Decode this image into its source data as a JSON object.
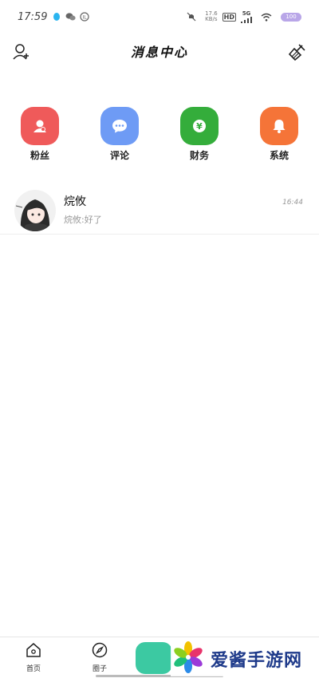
{
  "status_bar": {
    "time": "17:59",
    "net_speed_value": "17.6",
    "net_speed_unit": "KB/s",
    "hd": "HD",
    "signal": "5G",
    "battery": "100"
  },
  "header": {
    "title": "消息中心",
    "left_icon": "add-user-icon",
    "right_icon": "clear-broom-icon"
  },
  "categories": [
    {
      "label": "粉丝",
      "icon": "fans-icon",
      "color": "#ef5a5a"
    },
    {
      "label": "评论",
      "icon": "comment-icon",
      "color": "#6e9bf5"
    },
    {
      "label": "财务",
      "icon": "yuan-icon",
      "color": "#34ad3b"
    },
    {
      "label": "系统",
      "icon": "bell-icon",
      "color": "#f57438"
    }
  ],
  "conversation": {
    "name": "烷攸",
    "preview": "烷攸:好了",
    "time": "16:44"
  },
  "bottom_nav": {
    "home_label": "首页",
    "circle_label": "圈子"
  },
  "watermark": {
    "text": "爱酱手游网"
  }
}
